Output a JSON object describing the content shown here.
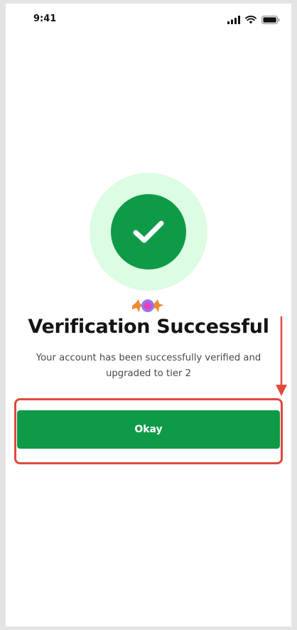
{
  "status_bar": {
    "time": "9:41",
    "icons": [
      "signal-icon",
      "wifi-icon",
      "battery-icon"
    ]
  },
  "success": {
    "icon": "checkmark-icon",
    "decoration": "confetti-icon",
    "title": "Verification Successful",
    "message": "Your account has been successfully verified and upgraded to tier 2"
  },
  "actions": {
    "okay_label": "Okay"
  },
  "colors": {
    "brand_green": "#0f9a48",
    "halo_green": "#dcfce3",
    "annotation_red": "#e0493d"
  }
}
